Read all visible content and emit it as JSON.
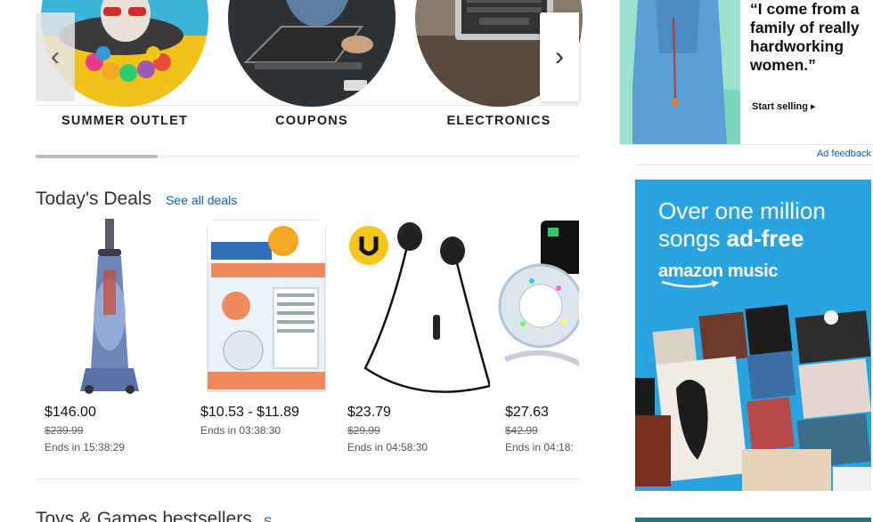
{
  "categories": [
    {
      "label": "SUMMER OUTLET",
      "icon": "dog-icon"
    },
    {
      "label": "COUPONS",
      "icon": "laptop-person-icon"
    },
    {
      "label": "ELECTRONICS",
      "icon": "laptop-icon"
    }
  ],
  "carousel": {
    "prev_icon": "‹",
    "next_icon": "›"
  },
  "deals": {
    "title": "Today's Deals",
    "see_all": "See all deals",
    "items": [
      {
        "name": "vacuum",
        "price": "$146.00",
        "was": "$239.99",
        "ends": "Ends in 15:38:29"
      },
      {
        "name": "sinkshroom",
        "price": "$10.53 - $11.89",
        "was": "",
        "ends": "Ends in 03:38:30"
      },
      {
        "name": "earphones",
        "price": "$23.79",
        "was": "$29.99",
        "ends": "Ends in 04:58:30"
      },
      {
        "name": "led-strip",
        "price": "$27.63",
        "was": "$42.99",
        "ends": "Ends in 04:18:"
      }
    ]
  },
  "next_section": {
    "title": "Toys & Games bestsellers",
    "link": "S"
  },
  "sidebar": {
    "ad_quote": "“I come from a family of really hardworking women.”",
    "ad_cta": "Start selling ▸",
    "ad_feedback": "Ad feedback",
    "music_line1": "Over one million",
    "music_line2_plain": "songs ",
    "music_line2_bold": "ad-free",
    "music_brand": "amazon music"
  },
  "colors": {
    "link": "#0066c0",
    "music_bg": "#2aa4e0"
  }
}
